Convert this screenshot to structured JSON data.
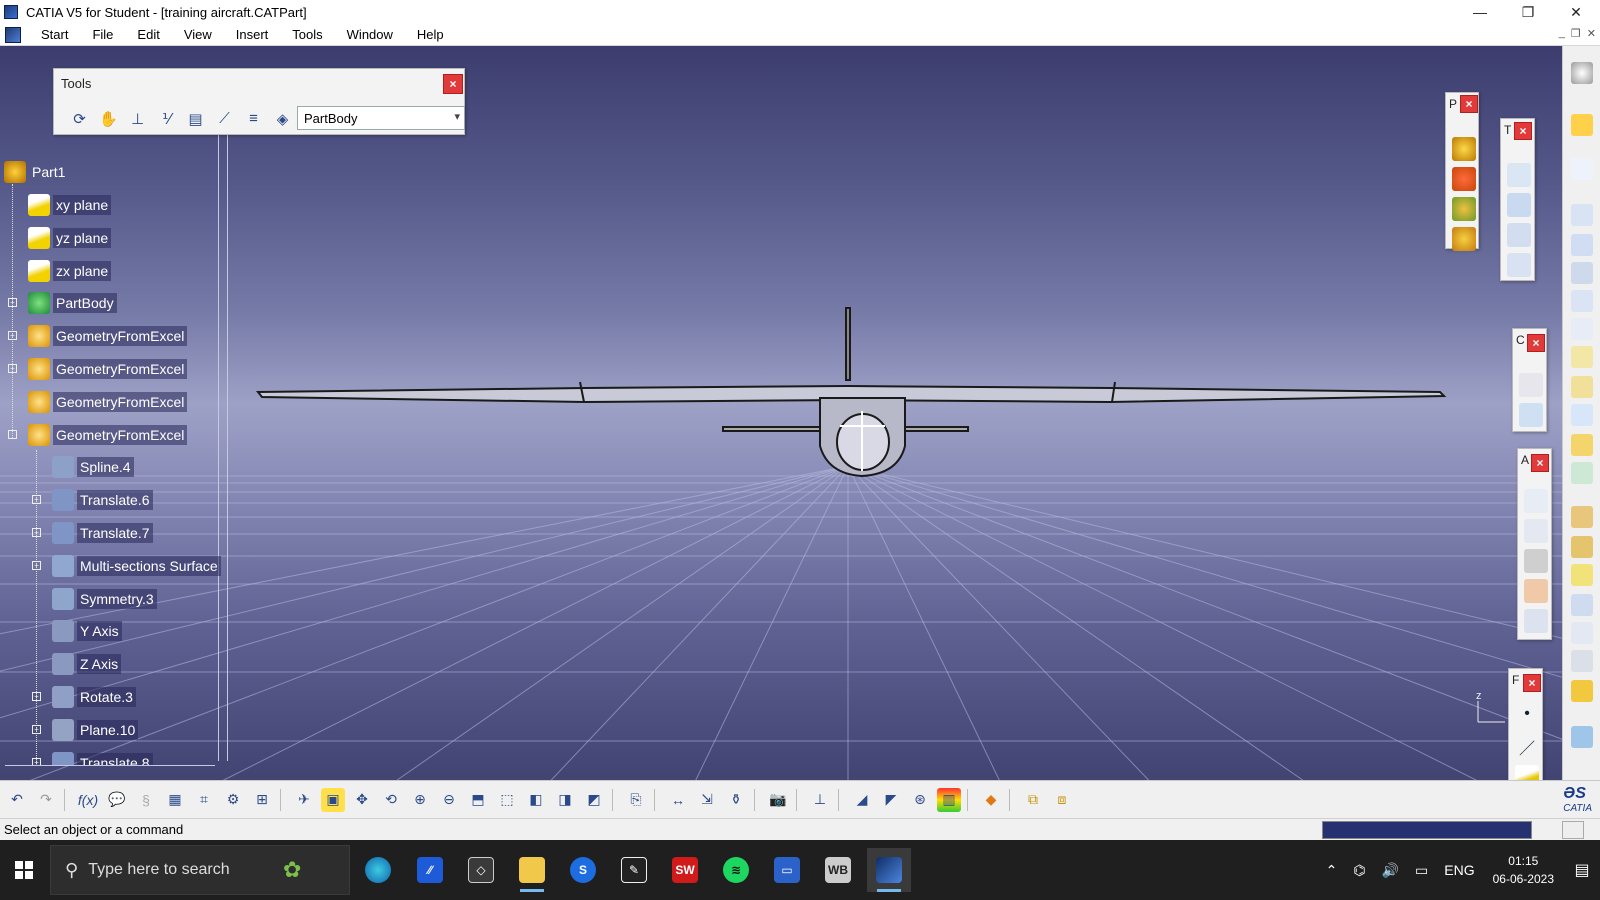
{
  "window": {
    "title": "CATIA V5 for Student - [training aircraft.CATPart]",
    "min": "—",
    "restore": "❐",
    "close": "✕"
  },
  "menu": {
    "items": [
      "Start",
      "File",
      "Edit",
      "View",
      "Insert",
      "Tools",
      "Window",
      "Help"
    ]
  },
  "tools_toolbar": {
    "title": "Tools",
    "close": "×",
    "dropdown_value": "PartBody"
  },
  "tree": {
    "root": "Part1",
    "items": [
      {
        "label": "xy plane",
        "icon": "plane-icon",
        "level": 1,
        "expander": ""
      },
      {
        "label": "yz plane",
        "icon": "plane-icon",
        "level": 1,
        "expander": ""
      },
      {
        "label": "zx plane",
        "icon": "plane-icon",
        "level": 1,
        "expander": ""
      },
      {
        "label": "PartBody",
        "icon": "gear-body-icon",
        "level": 1,
        "expander": "+"
      },
      {
        "label": "GeometryFromExcel",
        "icon": "geometry-set-icon",
        "level": 1,
        "expander": "+"
      },
      {
        "label": "GeometryFromExcel",
        "icon": "geometry-set-icon",
        "level": 1,
        "expander": "+"
      },
      {
        "label": "GeometryFromExcel",
        "icon": "geometry-set-icon",
        "level": 1,
        "expander": ""
      },
      {
        "label": "GeometryFromExcel",
        "icon": "geometry-set-icon",
        "level": 1,
        "expander": "-"
      },
      {
        "label": "Spline.4",
        "icon": "spline-icon",
        "level": 2,
        "expander": ""
      },
      {
        "label": "Translate.6",
        "icon": "translate-icon",
        "level": 2,
        "expander": "+"
      },
      {
        "label": "Translate.7",
        "icon": "translate-icon",
        "level": 2,
        "expander": "+"
      },
      {
        "label": "Multi-sections Surface",
        "icon": "multi-section-surface-icon",
        "level": 2,
        "expander": "+"
      },
      {
        "label": "Symmetry.3",
        "icon": "symmetry-icon",
        "level": 2,
        "expander": ""
      },
      {
        "label": "Y Axis",
        "icon": "axis-icon",
        "level": 2,
        "expander": ""
      },
      {
        "label": "Z Axis",
        "icon": "axis-icon",
        "level": 2,
        "expander": ""
      },
      {
        "label": "Rotate.3",
        "icon": "rotate-icon",
        "level": 2,
        "expander": "+"
      },
      {
        "label": "Plane.10",
        "icon": "plane-feature-icon",
        "level": 2,
        "expander": "+"
      },
      {
        "label": "Translate.8",
        "icon": "translate-icon",
        "level": 2,
        "expander": "+"
      }
    ]
  },
  "float_toolbars": [
    {
      "label": "P",
      "close": "×"
    },
    {
      "label": "T",
      "close": "×"
    },
    {
      "label": "C",
      "close": "×"
    },
    {
      "label": "A",
      "close": "×"
    },
    {
      "label": "F",
      "close": "×"
    }
  ],
  "compass": {
    "axis_label": "z"
  },
  "status": {
    "message": "Select an object or a command"
  },
  "brand": {
    "logo_text": "CATIA"
  },
  "taskbar": {
    "search_placeholder": "Type here to search",
    "apps": [
      "edge",
      "mathcad",
      "unity",
      "file-explorer",
      "skype",
      "inkscape",
      "solidworks-2020",
      "spotify",
      "media",
      "workbench",
      "catia"
    ],
    "sw_label": "SW",
    "wb_label": "WB",
    "lang": "ENG",
    "time": "01:15",
    "date": "06-06-2023"
  },
  "colors": {
    "viewport_top": "#3c3d6e",
    "viewport_mid": "#9ea1c6",
    "close_red": "#e03a3a",
    "taskbar": "#1f1f1f"
  }
}
